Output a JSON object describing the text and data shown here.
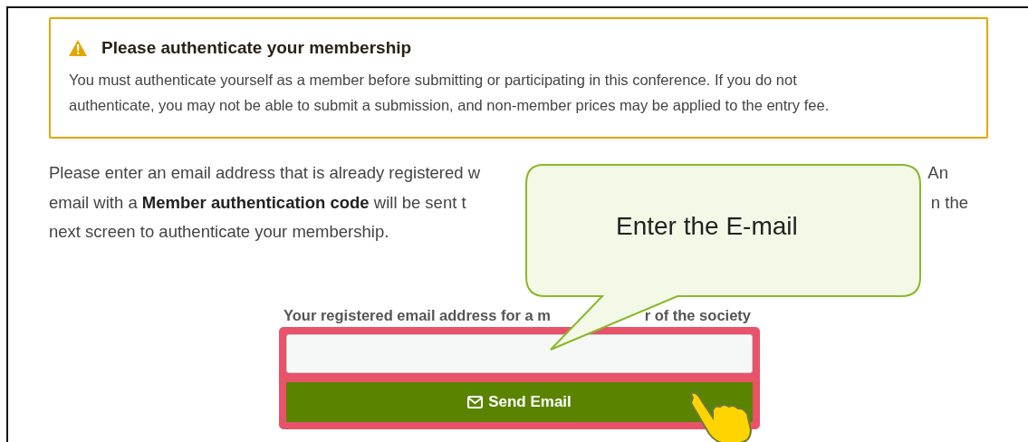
{
  "alert": {
    "title": "Please authenticate your membership",
    "body": "You must authenticate yourself as a member before submitting or participating in this conference. If you do not authenticate, you may not be able to submit a submission, and non-member prices may be applied to the entry fee."
  },
  "intro": [
    {
      "left": "Please enter an email address that is already registered w",
      "right": "An"
    },
    {
      "left": "email with a **Member authentication code** will be sent t",
      "right": "n the"
    },
    {
      "left": "next screen to authenticate your membership."
    }
  ],
  "form": {
    "label_left": "Your registered email address for a m",
    "label_right": "r of the society",
    "button": "Send Email",
    "highlighted": true
  },
  "callout": {
    "text": "Enter the E-mail"
  }
}
